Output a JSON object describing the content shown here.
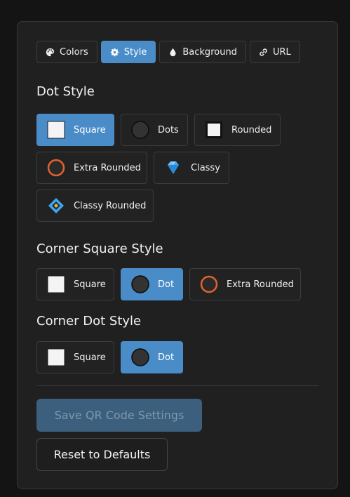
{
  "tabs": [
    {
      "label": "Colors",
      "icon": "palette-icon",
      "active": false
    },
    {
      "label": "Style",
      "icon": "gear-icon",
      "active": true
    },
    {
      "label": "Background",
      "icon": "droplet-icon",
      "active": false
    },
    {
      "label": "URL",
      "icon": "link-icon",
      "active": false
    }
  ],
  "dot_style": {
    "title": "Dot Style",
    "options": [
      {
        "label": "Square",
        "icon": "square-icon",
        "selected": true
      },
      {
        "label": "Dots",
        "icon": "circle-icon",
        "selected": false
      },
      {
        "label": "Rounded",
        "icon": "rounded-square-icon",
        "selected": false
      },
      {
        "label": "Extra Rounded",
        "icon": "extra-rounded-icon",
        "selected": false
      },
      {
        "label": "Classy",
        "icon": "diamond-gem-icon",
        "selected": false
      },
      {
        "label": "Classy Rounded",
        "icon": "classy-rounded-icon",
        "selected": false
      }
    ]
  },
  "corner_square_style": {
    "title": "Corner Square Style",
    "options": [
      {
        "label": "Square",
        "icon": "square-icon",
        "selected": false
      },
      {
        "label": "Dot",
        "icon": "circle-icon",
        "selected": true
      },
      {
        "label": "Extra Rounded",
        "icon": "extra-rounded-icon",
        "selected": false
      }
    ]
  },
  "corner_dot_style": {
    "title": "Corner Dot Style",
    "options": [
      {
        "label": "Square",
        "icon": "square-icon",
        "selected": false
      },
      {
        "label": "Dot",
        "icon": "circle-icon",
        "selected": true
      }
    ]
  },
  "actions": {
    "save_label": "Save QR Code Settings",
    "reset_label": "Reset to Defaults"
  },
  "colors": {
    "accent": "#4a8cc7",
    "extra_rounded_ring": "#e0622e",
    "gem": "#3fa7f0"
  }
}
